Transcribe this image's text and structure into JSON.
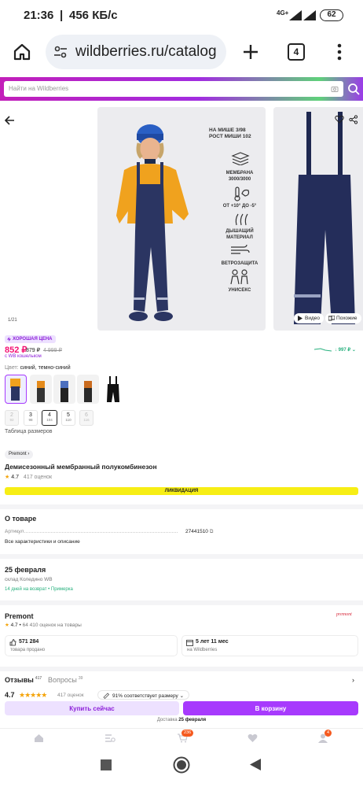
{
  "status": {
    "time": "21:36",
    "speed": "456 КБ/с",
    "network": "4G+",
    "battery": "62"
  },
  "browser": {
    "url": "wildberries.ru/catalog",
    "tab_count": "4"
  },
  "site": {
    "search_placeholder": "Найти на Wildberries"
  },
  "gallery": {
    "counter": "1/21",
    "size_note": "НА МИШЕ 3/98\nРОСТ МИШИ 102",
    "features": [
      "МЕМБРАНА\n3000/3000",
      "ОТ +10° ДО -5°",
      "ДЫШАЩИЙ\nМАТЕРИАЛ",
      "ВЕТРОЗАЩИТА",
      "УНИСЕКС"
    ],
    "video_label": "Видео",
    "similar_label": "Похожие"
  },
  "product": {
    "badge": "ХОРОШАЯ ЦЕНА",
    "price": "852 ₽",
    "price_alt": "879 ₽",
    "price_old": "4 999 ₽",
    "wallet_note": "с WB кошельком",
    "trend_price": "997 ₽",
    "color_label": "Цвет:",
    "color_value": "синий, темно-синий",
    "sizes": [
      {
        "size": "2",
        "height": "92",
        "available": false
      },
      {
        "size": "3",
        "height": "98",
        "available": true
      },
      {
        "size": "4",
        "height": "104",
        "available": true
      },
      {
        "size": "5",
        "height": "110",
        "available": true
      },
      {
        "size": "6",
        "height": "116",
        "available": false
      }
    ],
    "size_table": "Таблица размеров",
    "brand": "Premont",
    "title": "Демисезонный мембранный полукомбинезон",
    "rating": "4.7",
    "reviews_count": "417 оценок",
    "sale_banner": "ЛИКВИДАЦИЯ"
  },
  "about": {
    "heading": "О товаре",
    "article_label": "Артикул",
    "article_value": "27441510",
    "all_specs": "Все характеристики и описание"
  },
  "delivery": {
    "date": "25 февраля",
    "warehouse": "склад Коледино WB",
    "return_info": "14 дней на возврат",
    "fitting": "Примерка"
  },
  "seller": {
    "name": "Premont",
    "logo_text": "premont",
    "rating": "4.7",
    "rating_info": "64 410 оценок на товары",
    "sold_value": "571 284",
    "sold_label": "товара продано",
    "years_value": "5 лет 11 мес",
    "years_label": "на Wildberries"
  },
  "reviews": {
    "tab_reviews": "Отзывы",
    "reviews_count": "417",
    "tab_questions": "Вопросы",
    "questions_count": "39",
    "rating": "4.7",
    "rating_count": "417 оценок",
    "size_match": "91% соответствует размеру"
  },
  "actions": {
    "buy_now": "Купить сейчас",
    "add_to_cart": "В корзину",
    "delivery_label": "Доставка",
    "delivery_date": "25 февраля"
  },
  "nav": {
    "cart_badge": "236",
    "profile_badge": "4"
  },
  "colors": {
    "accent": "#a73afd",
    "accent_dark": "#8d1fd9",
    "price": "#f41173",
    "badge": "#ede1ff",
    "green": "#26b07d",
    "sale": "#f7ee15"
  }
}
